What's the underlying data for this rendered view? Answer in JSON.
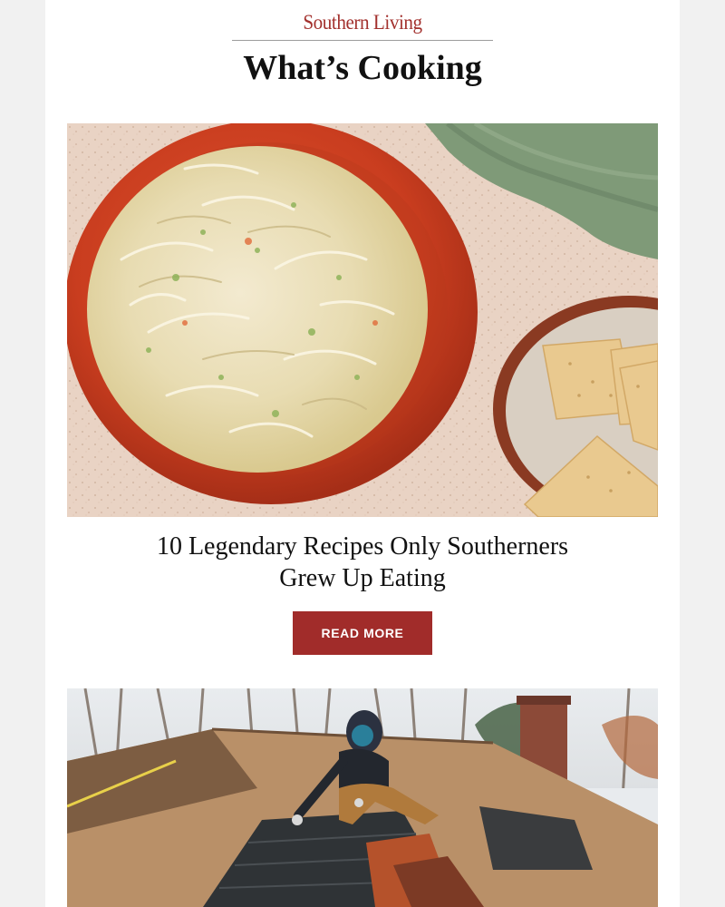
{
  "brand": {
    "logo_text": "Southern Living"
  },
  "section": {
    "title": "What’s Cooking"
  },
  "article": {
    "title_line_1": "10 Legendary Recipes Only Southerners",
    "title_line_2": "Grew Up Eating",
    "cta_label": "READ MORE"
  },
  "colors": {
    "brand_red": "#a3312e",
    "button_red": "#a12c2a",
    "page_bg": "#f1f1f1"
  }
}
